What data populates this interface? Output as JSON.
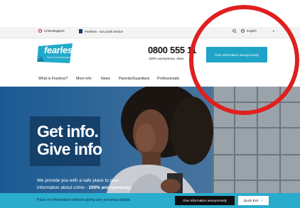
{
  "topbar": {
    "crimestoppers_label": "Crimestoppers",
    "fearless_label": "Fearless - our youth service",
    "language_label": "English",
    "language_chevron": "▾"
  },
  "header": {
    "logo_name": "fearless",
    "logo_tagline": "Part of Crimestoppers",
    "phone": "0800 555 11",
    "phone_sub": "100% anonymous. Alwa",
    "give_button": "Give information anonymously"
  },
  "nav": {
    "items": [
      "What is Fearless?",
      "More info",
      "News",
      "Parents/Guardians",
      "Professionals"
    ]
  },
  "hero": {
    "title_line1": "Get info.",
    "title_line2": "Give info",
    "body_line1": "We provide you with a safe place to give",
    "body_line2_prefix": "information about crime - ",
    "body_line2_bold": "100% anonymously."
  },
  "banner": {
    "text": "Pass on information without giving any personal details.",
    "give_button": "Give information anonymously",
    "quick_exit": "Quick Exit",
    "quick_exit_icon": "↗"
  },
  "colors": {
    "brand": "#1fa3c6",
    "hero_bg": "#174e82",
    "banner_bg": "#2aaccd",
    "annotation_ring": "#e01f1f"
  },
  "icons": [
    "crimestoppers-logo-icon",
    "fearless-logo-icon",
    "search-icon",
    "globe-icon",
    "chevron-down-icon",
    "exit-arrow-icon"
  ]
}
